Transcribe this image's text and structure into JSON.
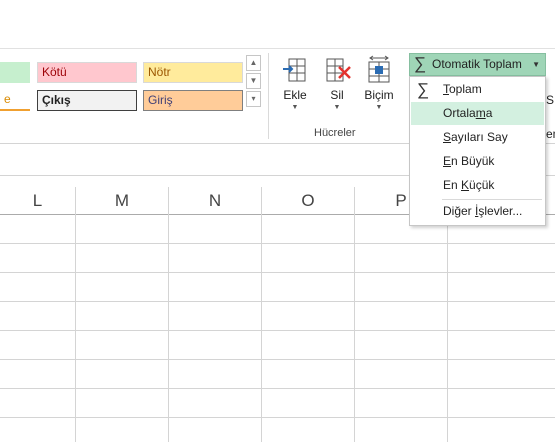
{
  "cell_styles": {
    "bad": {
      "label": "Kötü",
      "bg": "#ffc7ce",
      "color": "#9c0006"
    },
    "neutral": {
      "label": "Nötr",
      "bg": "#ffeb9c",
      "color": "#9c5700"
    },
    "check": {
      "label": "Çıkış",
      "bg": "#f2f2f2",
      "color": "#222222"
    },
    "input": {
      "label": "Giriş",
      "bg": "#ffcc99",
      "color": "#3f3f76"
    },
    "partial_left": "e"
  },
  "cells_group": {
    "insert_label": "Ekle",
    "delete_label": "Sil",
    "format_label": "Biçim",
    "group_label": "Hücreler"
  },
  "autosum": {
    "label": "Otomatik Toplam",
    "items": [
      {
        "pre": "",
        "u": "T",
        "post": "oplam",
        "icon": "sigma"
      },
      {
        "pre": "Ortala",
        "u": "m",
        "post": "a",
        "icon": ""
      },
      {
        "pre": "",
        "u": "S",
        "post": "ayıları Say",
        "icon": ""
      },
      {
        "pre": "",
        "u": "E",
        "post": "n Büyük",
        "icon": ""
      },
      {
        "pre": "En ",
        "u": "K",
        "post": "üçük",
        "icon": ""
      },
      {
        "pre": "Diğer ",
        "u": "İ",
        "post": "şlevler...",
        "icon": ""
      }
    ]
  },
  "right_clipped": {
    "top": "Sı",
    "bottom": "en"
  },
  "columns": [
    "L",
    "M",
    "N",
    "O",
    "P"
  ],
  "colors": {
    "accent_green": "#9fd5b7",
    "highlight": "#d3f0e0",
    "grid": "#d4d4d4",
    "red_x": "#e3322d",
    "blue_icon": "#2b6cb3"
  }
}
